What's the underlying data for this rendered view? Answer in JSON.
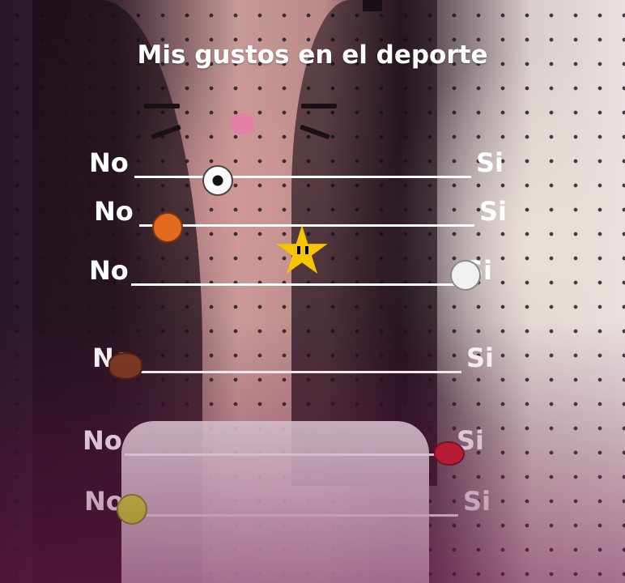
{
  "title": "Mis gustos en el deporte",
  "scale": {
    "left_label": "No",
    "right_label": "Si"
  },
  "rows": [
    {
      "sport": "soccer",
      "icon": "soccer-ball-icon",
      "position": 0.24
    },
    {
      "sport": "basketball",
      "icon": "basketball-icon",
      "position": 0.05
    },
    {
      "sport": "volleyball",
      "icon": "volleyball-icon",
      "position": 0.95
    },
    {
      "sport": "american-football",
      "icon": "american-football-icon",
      "position": 0.0
    },
    {
      "sport": "boxing",
      "icon": "boxing-glove-icon",
      "position": 1.0
    },
    {
      "sport": "softball",
      "icon": "softball-icon",
      "position": 0.0
    }
  ],
  "stickers": [
    "star-icon"
  ],
  "colors": {
    "text": "#ffffff",
    "star": "#f6c400"
  }
}
